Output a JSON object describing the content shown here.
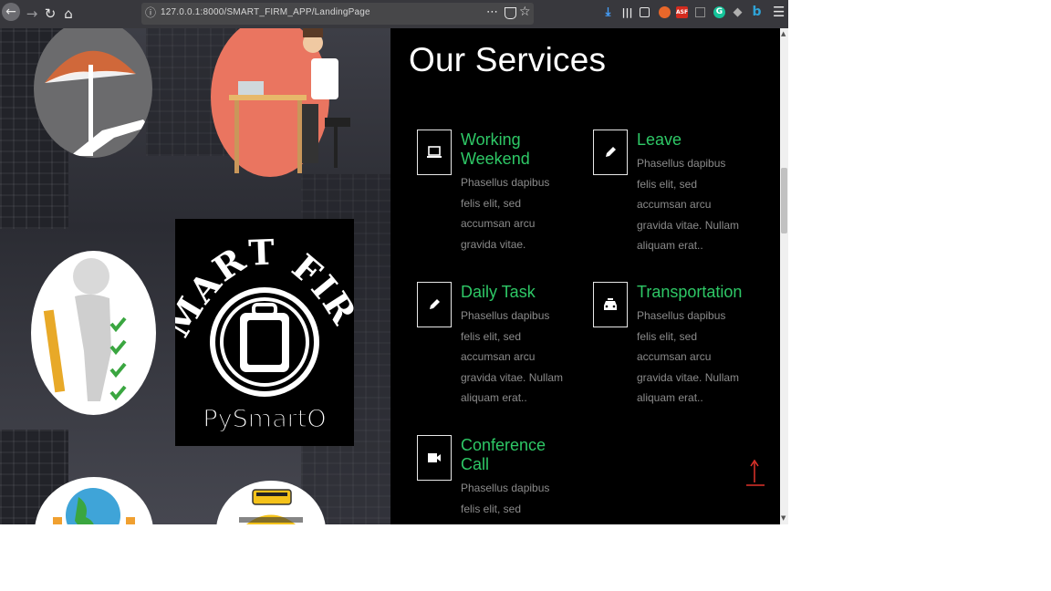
{
  "browser": {
    "url": "127.0.0.1:8000/SMART_FIRM_APP/LandingPage",
    "extensions": [
      "download-icon",
      "library-icon",
      "sidebar-icon",
      "ext-orange-icon",
      "ext-asf-icon",
      "ext-square-icon",
      "ext-grammarly-icon",
      "ext-diamond-icon",
      "ext-bing-icon"
    ],
    "ext_asf_label": "ASF",
    "ext_grammarly_label": "G",
    "ext_bing_label": "b"
  },
  "logo": {
    "title": "SMART FIRM",
    "subtitle": "PySmartO"
  },
  "services": {
    "heading": "Our Services",
    "items": [
      {
        "title": "Working Weekend",
        "desc": "Phasellus dapibus felis elit, sed accumsan arcu gravida vitae.",
        "icon": "laptop-icon"
      },
      {
        "title": "Leave",
        "desc": "Phasellus dapibus felis elit, sed accumsan arcu gravida vitae. Nullam aliquam erat..",
        "icon": "pencil-icon"
      },
      {
        "title": "Daily Task",
        "desc": "Phasellus dapibus felis elit, sed accumsan arcu gravida vitae. Nullam aliquam erat..",
        "icon": "pencil-icon"
      },
      {
        "title": "Transportation",
        "desc": "Phasellus dapibus felis elit, sed accumsan arcu gravida vitae. Nullam aliquam erat..",
        "icon": "taxi-icon"
      },
      {
        "title": "Conference Call",
        "desc": "Phasellus dapibus felis elit, sed accumsan arcu",
        "icon": "video-camera-icon"
      }
    ]
  },
  "colors": {
    "accent": "#2ec866",
    "panel": "#000000",
    "back_to_top": "#e0332b"
  }
}
